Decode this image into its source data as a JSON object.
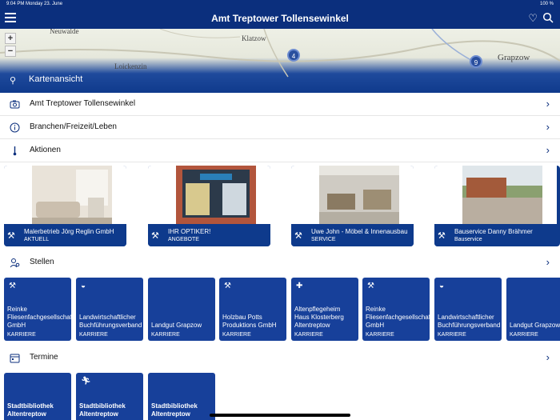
{
  "status": {
    "time_date": "9:04 PM   Monday 23. June",
    "battery": "100 %"
  },
  "header": {
    "title": "Amt Treptower Tollensewinkel"
  },
  "map": {
    "labels": [
      "Neuwalde",
      "Klatzow",
      "Loickenzin",
      "Grapzow"
    ],
    "clusters": [
      "4",
      "9"
    ],
    "zoom_in": "+",
    "zoom_out": "−",
    "caption": "Kartenansicht"
  },
  "menu": [
    {
      "label": "Amt Treptower Tollensewinkel",
      "icon": "camera-icon"
    },
    {
      "label": "Branchen/Freizeit/Leben",
      "icon": "info-icon"
    },
    {
      "label": "Aktionen",
      "icon": "thermometer-icon"
    }
  ],
  "featured": [
    {
      "title": "Malerbetrieb Jörg Reglin GmbH",
      "category": "AKTUELL"
    },
    {
      "title": "IHR OPTIKER!",
      "category": "ANGEBOTE"
    },
    {
      "title": "Uwe John - Möbel & Innenausbau",
      "category": "SERVICE"
    },
    {
      "title": "Bauservice Danny Brähmer",
      "category": "Bauservice"
    }
  ],
  "stellen": {
    "label": "Stellen",
    "items": [
      {
        "name": "Reinke Fliesenfachgesellschaft GmbH",
        "category": "KARRIERE"
      },
      {
        "name": "Landwirtschaftlicher Buchführungsverband",
        "category": "KARRIERE"
      },
      {
        "name": "Landgut Grapzow",
        "category": "KARRIERE"
      },
      {
        "name": "Holzbau Potts Produktions GmbH",
        "category": "KARRIERE"
      },
      {
        "name": "Altenpflegeheim Haus Klosterberg Altentreptow",
        "category": "KARRIERE"
      },
      {
        "name": "Reinke Fliesenfachgesellschaft GmbH",
        "category": "KARRIERE"
      },
      {
        "name": "Landwirtschaftlicher Buchführungsverband",
        "category": "KARRIERE"
      },
      {
        "name": "Landgut Grapzow",
        "category": "KARRIERE"
      }
    ]
  },
  "termine": {
    "label": "Termine",
    "items": [
      {
        "name": "Stadtbibliothek Altentreptow"
      },
      {
        "name": "Stadtbibliothek Altentreptow"
      },
      {
        "name": "Stadtbibliothek Altentreptow"
      }
    ]
  },
  "colors": {
    "brand": "#0b2f7d",
    "card": "#17409a"
  }
}
